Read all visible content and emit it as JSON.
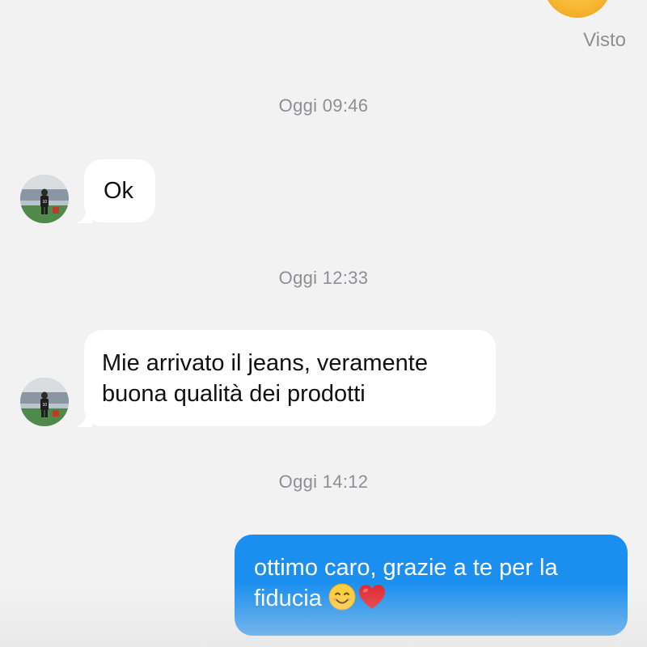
{
  "conversation": {
    "read_receipt": "Visto",
    "timestamps": [
      "Oggi 09:46",
      "Oggi 12:33",
      "Oggi 14:12"
    ],
    "messages": [
      {
        "direction": "incoming",
        "text": "Ok"
      },
      {
        "direction": "incoming",
        "text": "Mie arrivato il jeans, veramente\nbuona qualità dei prodotti"
      },
      {
        "direction": "outgoing",
        "text": "ottimo caro, grazie a te per la\nfiducia ",
        "emojis": [
          "smiling-face-icon",
          "red-heart-icon"
        ]
      }
    ]
  },
  "colors": {
    "background": "#f2f2f2",
    "incoming_bubble": "#ffffff",
    "outgoing_bubble": "#1a8ff0",
    "meta_text": "#8e8e93"
  }
}
